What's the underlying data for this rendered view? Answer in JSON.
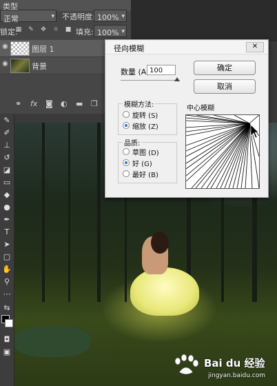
{
  "layers_panel": {
    "row1": {
      "label": "类型",
      "opacity_label": "不透明度:",
      "opacity_value": "100%"
    },
    "blend_mode": "正常",
    "lock_label": "锁定:",
    "fill_label": "填充:",
    "fill_value": "100%",
    "layers": [
      {
        "name": "图层 1",
        "selected": true
      },
      {
        "name": "背景",
        "selected": false
      }
    ],
    "toolbar_icons": [
      "link-icon",
      "fx",
      "mask-icon",
      "adjustment-icon",
      "folder-icon",
      "new-layer-icon",
      "trash-icon"
    ],
    "toolbar_fx": "fx"
  },
  "dialog": {
    "title": "径向模糊",
    "close": "✕",
    "amount_label": "数量 (A)",
    "amount_value": "100",
    "ok_label": "确定",
    "cancel_label": "取消",
    "method_label": "模糊方法:",
    "method_options": [
      {
        "label": "旋转 (S)",
        "checked": false
      },
      {
        "label": "缩放 (Z)",
        "checked": true
      }
    ],
    "quality_label": "品质:",
    "quality_options": [
      {
        "label": "草图 (D)",
        "checked": false
      },
      {
        "label": "好 (G)",
        "checked": true
      },
      {
        "label": "最好 (B)",
        "checked": false
      }
    ],
    "center_label": "中心模糊"
  },
  "watermark": {
    "brand": "Bai du 经验",
    "url": "jingyan.baidu.com"
  },
  "colors": {
    "accent": "#2a6fd6",
    "panel": "#464646",
    "dialog": "#f0f0f0"
  }
}
